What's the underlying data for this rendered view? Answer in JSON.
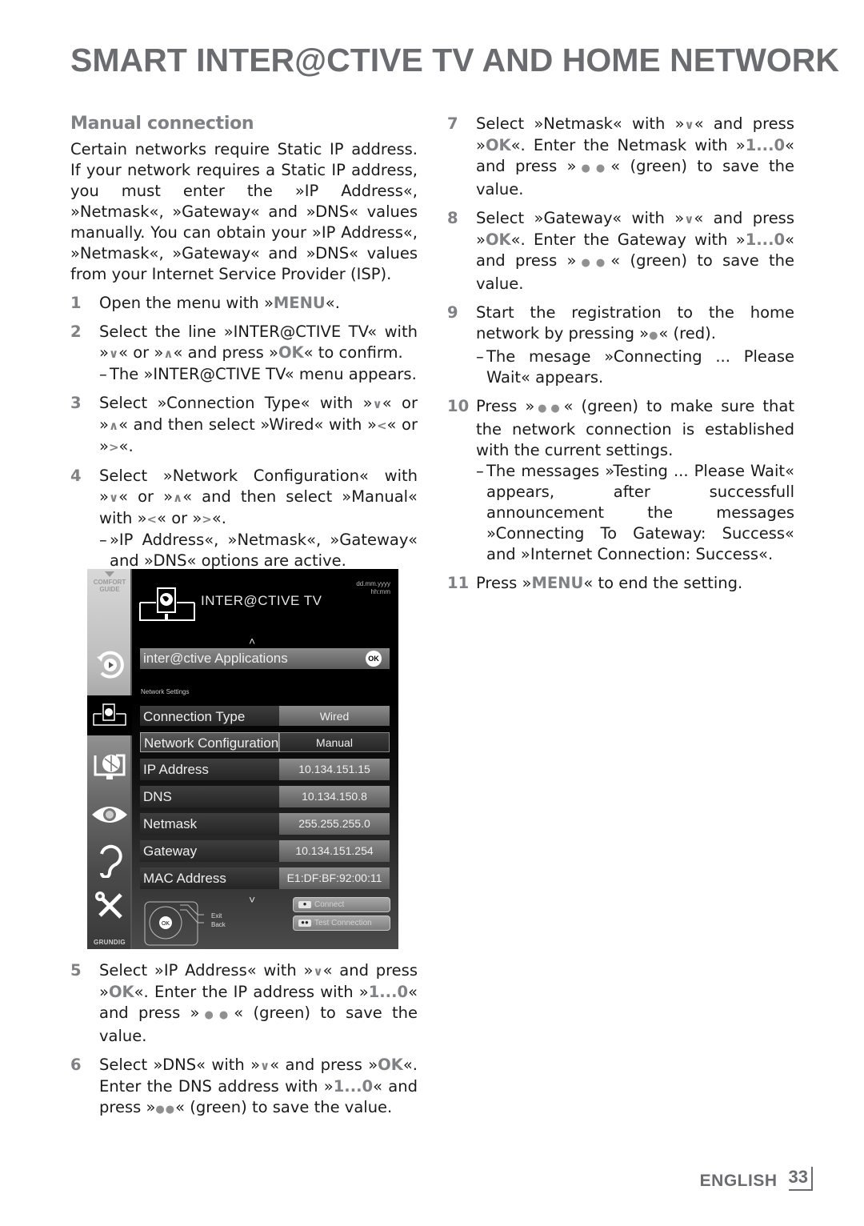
{
  "page": {
    "title": "SMART INTER@CTIVE TV AND HOME NETWORK",
    "footer_language": "ENGLISH",
    "page_number": "33"
  },
  "section": {
    "title": "Manual connection",
    "intro": "Certain networks require Static IP address. If your network requires a Static IP address, you must enter the »IP Address«, »Netmask«, »Gateway« and »DNS« values manually. You can obtain your »IP Address«, »Netmask«, »Gateway« and »DNS« values from your Internet Service Provider (ISP)."
  },
  "steps": [
    {
      "num": "1",
      "parts": [
        "Open the menu with »",
        "MENU",
        "«."
      ]
    },
    {
      "num": "2",
      "parts": [
        "Select the line »INTER@CTIVE TV« with »",
        "V",
        "« or »",
        "Λ",
        "« and press »",
        "OK",
        "« to confirm."
      ],
      "sub": "The »INTER@CTIVE TV« menu appears."
    },
    {
      "num": "3",
      "parts": [
        "Select »Connection Type« with »",
        "V",
        "« or »",
        "Λ",
        "« and then select »Wired« with »",
        "<",
        "« or »",
        ">",
        "«."
      ]
    },
    {
      "num": "4",
      "parts": [
        "Select »Network Configuration« with »",
        "V",
        "« or »",
        "Λ",
        "« and then select »Manual« with »",
        "<",
        "« or »",
        ">",
        "«."
      ],
      "sub": "»IP Address«, »Netmask«, »Gateway« and »DNS« options are active."
    },
    {
      "num": "5",
      "parts": [
        "Select »IP Address« with »",
        "V",
        "« and press »",
        "OK",
        "«. Enter the IP address with »",
        "1...0",
        "« and press »",
        "●●",
        "« (green) to save the value."
      ]
    },
    {
      "num": "6",
      "parts": [
        "Select »DNS« with »",
        "V",
        "« and press »",
        "OK",
        "«. Enter the DNS address with »",
        "1...0",
        "« and press »",
        "●●",
        "« (green) to save the value."
      ]
    },
    {
      "num": "7",
      "parts": [
        "Select »Netmask« with »",
        "V",
        "« and press »",
        "OK",
        "«. Enter the Netmask with »",
        "1...0",
        "« and press »",
        "●●",
        "« (green) to save the value."
      ]
    },
    {
      "num": "8",
      "parts": [
        "Select »Gateway« with »",
        "V",
        "« and press »",
        "OK",
        "«. Enter the Gateway with »",
        "1...0",
        "« and press »",
        "●●",
        "« (green) to save the value."
      ]
    },
    {
      "num": "9",
      "parts": [
        "Start the registration to the home network by pressing »",
        "●",
        "« (red)."
      ],
      "sub": "The mesage »Connecting ... Please Wait« appears."
    },
    {
      "num": "10",
      "parts": [
        "Press »",
        "●●",
        "« (green) to make sure that the network connection is established with the current settings."
      ],
      "sub": "The messages »Testing ... Please Wait« appears, after successfull announcement the messages »Connecting To Gateway: Success« and »Internet Connection: Success«."
    },
    {
      "num": "11",
      "parts": [
        "Press »",
        "MENU",
        "« to end the setting."
      ]
    }
  ],
  "tv": {
    "side_label": "COMFORT GUIDE",
    "brand": "GRUNDIG",
    "date": "dd.mm.yyyy",
    "time": "hh:mm",
    "title": "INTER@CTIVE TV",
    "apps_label": "inter@ctive Applications",
    "ok_label": "OK",
    "network_settings_label": "Network Settings",
    "rows": [
      {
        "label": "Connection Type",
        "value": "Wired"
      },
      {
        "label": "Network Configuration",
        "value": "Manual"
      },
      {
        "label": "IP Address",
        "value": "10.134.151.15"
      },
      {
        "label": "DNS",
        "value": "10.134.150.8"
      },
      {
        "label": "Netmask",
        "value": "255.255.255.0"
      },
      {
        "label": "Gateway",
        "value": "10.134.151.254"
      },
      {
        "label": "MAC Address",
        "value": "E1:DF:BF:92:00:11"
      }
    ],
    "remote_exit": "Exit",
    "remote_back": "Back",
    "remote_ok": "OK",
    "btn_connect": "Connect",
    "btn_test": "Test Connection"
  }
}
